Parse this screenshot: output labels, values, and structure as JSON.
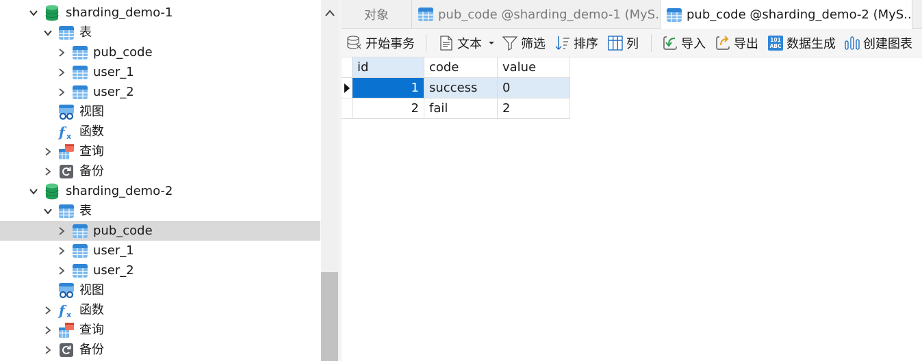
{
  "navigator": {
    "connections": [
      {
        "name": "sharding_demo-1",
        "tables_label": "表",
        "tables": [
          "pub_code",
          "user_1",
          "user_2"
        ],
        "views_label": "视图",
        "functions_label": "函数",
        "queries_label": "查询",
        "backups_label": "备份"
      },
      {
        "name": "sharding_demo-2",
        "tables_label": "表",
        "tables": [
          "pub_code",
          "user_1",
          "user_2"
        ],
        "views_label": "视图",
        "functions_label": "函数",
        "queries_label": "查询",
        "backups_label": "备份"
      }
    ],
    "selected": "sharding_demo-2 / pub_code"
  },
  "tabs": [
    {
      "label": "对象",
      "active": false
    },
    {
      "label": "pub_code @sharding_demo-1 (MyS...",
      "active": false
    },
    {
      "label": "pub_code @sharding_demo-2 (MyS...",
      "active": true
    }
  ],
  "toolbar": {
    "begin_transaction": "开始事务",
    "text": "文本",
    "filter": "筛选",
    "sort": "排序",
    "columns": "列",
    "import": "导入",
    "export": "导出",
    "data_generation": "数据生成",
    "create_chart": "创建图表"
  },
  "grid": {
    "columns": [
      "id",
      "code",
      "value"
    ],
    "rows": [
      [
        "1",
        "success",
        "0"
      ],
      [
        "2",
        "fail",
        "2"
      ]
    ]
  },
  "colors": {
    "accent": "#0a73d1",
    "selected_row": "#dce9f7",
    "tree_selected": "#d9d9d9",
    "db_green": "#1f9d55",
    "table_blue": "#2f86d6"
  }
}
